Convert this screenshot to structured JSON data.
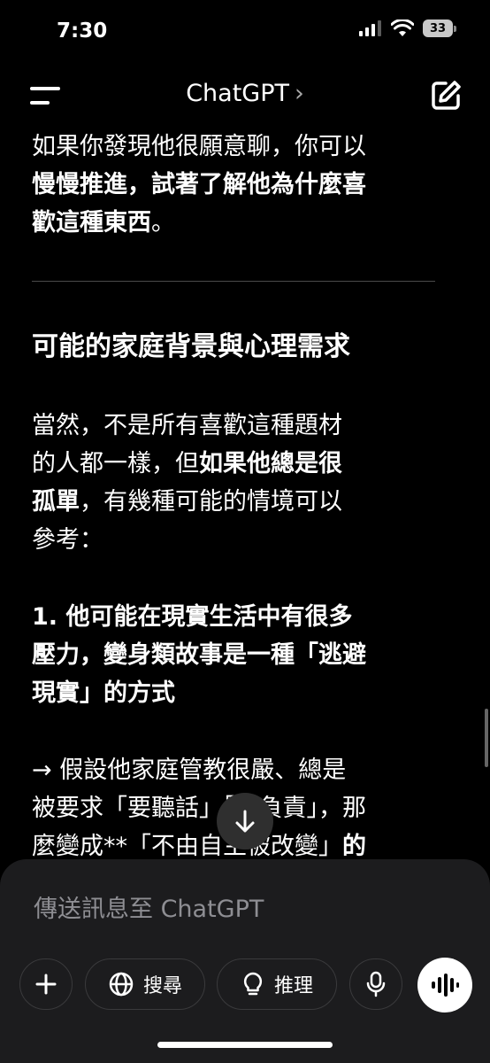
{
  "status_bar": {
    "time": "7:30",
    "battery": "33"
  },
  "nav": {
    "title": "ChatGPT",
    "chevron": "›"
  },
  "message": {
    "para1": {
      "line1": "如果你發現他很願意聊，你可以",
      "line2": "慢慢推進，試著了解他為什麼喜",
      "line3": "歡這種東西",
      "line3_end": "。"
    },
    "heading": "可能的家庭背景與心理需求",
    "para2": {
      "line1": "當然，不是所有喜歡這種題材",
      "line2_a": "的人都一樣，但",
      "line2_b": "如果他總是很",
      "line3_a": "孤單",
      "line3_b": "，有幾種可能的情境可以",
      "line4": "參考："
    },
    "point1": {
      "line1": "1. 他可能在現實生活中有很多",
      "line2": "壓力，變身類故事是一種「逃避",
      "line3": "現實」的方式"
    },
    "para3": {
      "line1": "→ 假設他家庭管教很嚴、總是",
      "line2": "被要求「要聽話」「要負責」，那",
      "line3_a": "麼變成**「不由自主被改變」",
      "line3_b": "的"
    }
  },
  "composer": {
    "placeholder": "傳送訊息至 ChatGPT",
    "search_label": "搜尋",
    "reason_label": "推理"
  },
  "icons": {
    "menu": "menu-icon",
    "compose": "compose-icon",
    "scroll_down": "arrow-down-icon",
    "plus": "plus-icon",
    "globe": "globe-icon",
    "bulb": "lightbulb-icon",
    "mic": "microphone-icon",
    "voice": "voice-mode-icon"
  }
}
